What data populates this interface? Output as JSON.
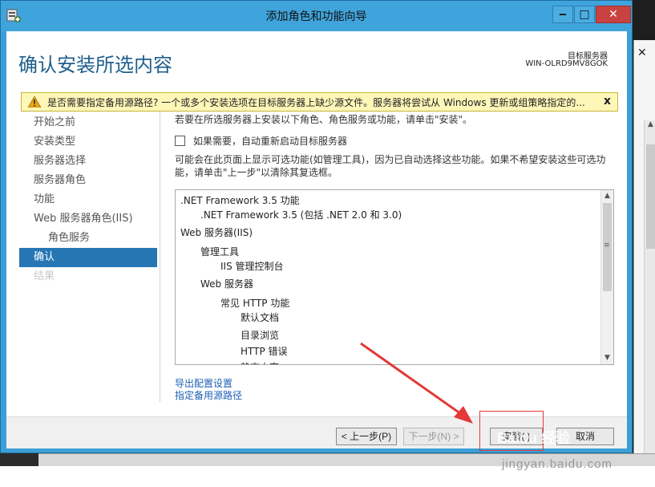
{
  "window": {
    "title": "添加角色和功能向导",
    "minimize_icon": "minimize-icon",
    "maximize_icon": "maximize-icon",
    "close_icon": "close-icon"
  },
  "header": {
    "title": "确认安装所选内容",
    "target_label": "目标服务器",
    "target_value": "WIN-OLRD9MV8GOK"
  },
  "warning": {
    "text": "是否需要指定备用源路径? 一个或多个安装选项在目标服务器上缺少源文件。服务器将尝试从 Windows 更新或组策略指定的...",
    "close": "x",
    "color": "#fff7b8"
  },
  "nav": {
    "items": [
      {
        "label": "开始之前",
        "state": "normal"
      },
      {
        "label": "安装类型",
        "state": "normal"
      },
      {
        "label": "服务器选择",
        "state": "normal"
      },
      {
        "label": "服务器角色",
        "state": "normal"
      },
      {
        "label": "功能",
        "state": "normal"
      },
      {
        "label": "Web 服务器角色(IIS)",
        "state": "normal"
      },
      {
        "label": "角色服务",
        "state": "sub"
      },
      {
        "label": "确认",
        "state": "active"
      },
      {
        "label": "结果",
        "state": "disabled"
      }
    ],
    "active_color": "#2676b3"
  },
  "content": {
    "intro": "若要在所选服务器上安装以下角色、角色服务或功能，请单击\"安装\"。",
    "checkbox_label": "如果需要，自动重新启动目标服务器",
    "checkbox_checked": false,
    "note": "可能会在此页面上显示可选功能(如管理工具)，因为已自动选择这些功能。如果不希望安装这些可选功能，请单击\"上一步\"以清除其复选框。",
    "features": [
      {
        "label": ".NET Framework 3.5 功能",
        "level": 0
      },
      {
        "label": ".NET Framework 3.5 (包括 .NET 2.0 和 3.0)",
        "level": 1
      },
      {
        "label": "Web 服务器(IIS)",
        "level": 0
      },
      {
        "label": "管理工具",
        "level": 1
      },
      {
        "label": "IIS 管理控制台",
        "level": 2
      },
      {
        "label": "Web 服务器",
        "level": 1
      },
      {
        "label": "常见 HTTP 功能",
        "level": 2
      },
      {
        "label": "默认文档",
        "level": 3
      },
      {
        "label": "目录浏览",
        "level": 3
      },
      {
        "label": "HTTP 错误",
        "level": 3
      },
      {
        "label": "静态内容",
        "level": 3
      }
    ],
    "links": {
      "export": "导出配置设置",
      "alt_source": "指定备用源路径"
    }
  },
  "footer": {
    "prev": "< 上一步(P)",
    "next": "下一步(N) >",
    "install": "安装(I)",
    "cancel": "取消"
  },
  "watermark": {
    "brand": "Baidu 经验",
    "url": "jingyan.baidu.com"
  }
}
